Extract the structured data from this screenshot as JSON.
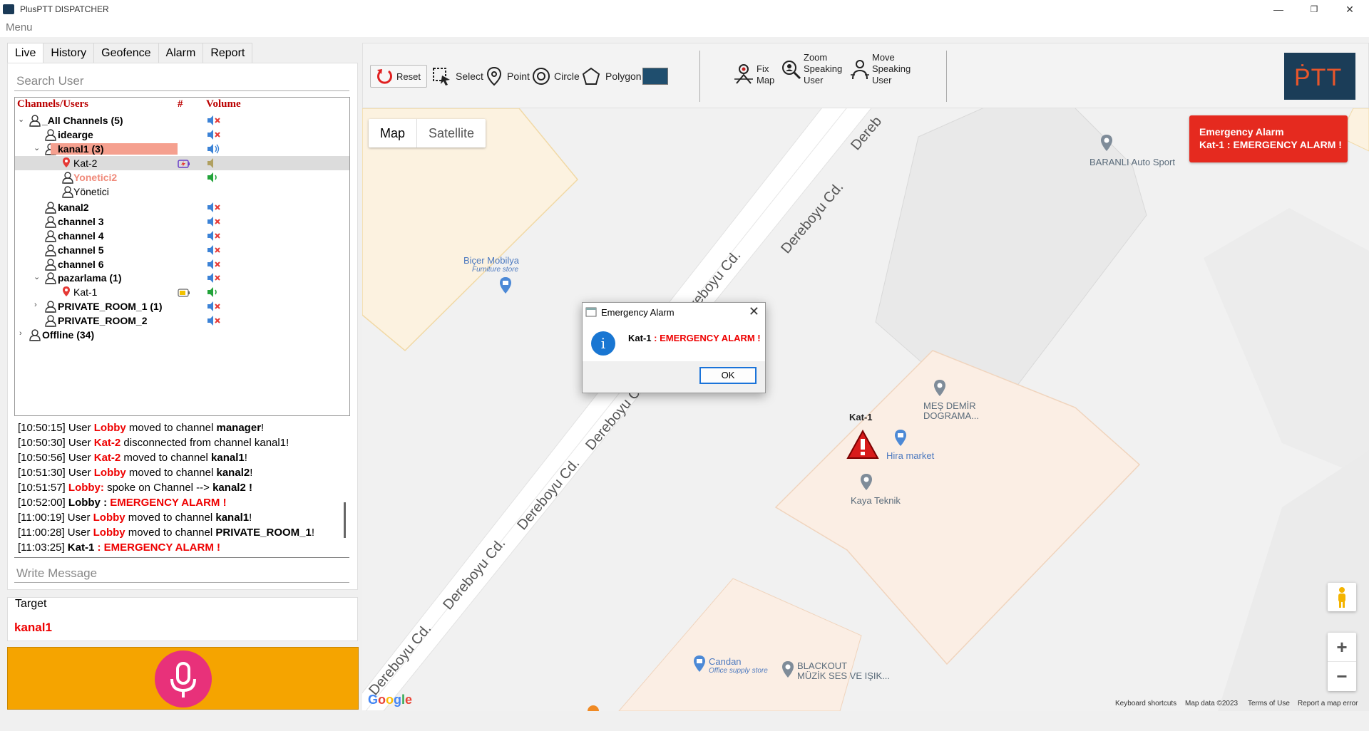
{
  "window": {
    "title": "PlusPTT DISPATCHER",
    "menu": "Menu",
    "min": "—",
    "restore": "❐",
    "close": "✕"
  },
  "tabs": [
    "Live",
    "History",
    "Geofence",
    "Alarm",
    "Report"
  ],
  "search": {
    "placeholder": "Search User"
  },
  "tree": {
    "headers": {
      "name": "Channels/Users",
      "num": "#",
      "volume": "Volume"
    },
    "rows": [
      {
        "label": "_All Channels (5)"
      },
      {
        "label": "idearge"
      },
      {
        "label": "kanal1 (3)"
      },
      {
        "label": "Kat-2"
      },
      {
        "label": "Yonetici2"
      },
      {
        "label": "Yönetici"
      },
      {
        "label": "kanal2"
      },
      {
        "label": "channel 3"
      },
      {
        "label": "channel 4"
      },
      {
        "label": "channel 5"
      },
      {
        "label": "channel 6"
      },
      {
        "label": "pazarlama (1)"
      },
      {
        "label": "Kat-1"
      },
      {
        "label": "PRIVATE_ROOM_1 (1)"
      },
      {
        "label": "PRIVATE_ROOM_2"
      },
      {
        "label": "Offline (34)"
      }
    ]
  },
  "log": [
    {
      "time": "[10:50:15]",
      "pre": "User ",
      "who": "Lobby",
      "mid": " moved to channel ",
      "obj": "manager",
      "end": "!"
    },
    {
      "time": "[10:50:30]",
      "pre": "User ",
      "who": "Kat-2",
      "mid": " disconnected from channel kanal1!",
      "obj": "",
      "end": ""
    },
    {
      "time": "[10:50:56]",
      "pre": "User ",
      "who": "Kat-2",
      "mid": " moved to channel ",
      "obj": "kanal1",
      "end": "!"
    },
    {
      "time": "[10:51:30]",
      "pre": "User ",
      "who": "Lobby",
      "mid": " moved to channel ",
      "obj": "kanal2",
      "end": "!"
    },
    {
      "time": "[10:51:57]",
      "pre": "",
      "who": "Lobby:",
      "mid": " spoke on Channel --> ",
      "obj": "kanal2",
      "end": " !"
    },
    {
      "time": "[10:52:00]",
      "pre": "",
      "who": "Lobby",
      "mid": " : ",
      "obj": "EMERGENCY ALARM !",
      "end": ""
    },
    {
      "time": "[11:00:19]",
      "pre": "User ",
      "who": "Lobby",
      "mid": " moved to channel ",
      "obj": "kanal1",
      "end": "!"
    },
    {
      "time": "[11:00:28]",
      "pre": "User ",
      "who": "Lobby",
      "mid": " moved to channel ",
      "obj": "PRIVATE_ROOM_1",
      "end": "!"
    },
    {
      "time": "[11:03:25]",
      "pre": "",
      "who": "Kat-1",
      "mid": " : ",
      "obj": "EMERGENCY ALARM !",
      "end": ""
    }
  ],
  "message": {
    "placeholder": "Write Message"
  },
  "target": {
    "label": "Target",
    "value": "kanal1"
  },
  "toolbar": {
    "reset": "Reset",
    "select": "Select",
    "point": "Point",
    "circle": "Circle",
    "polygon": "Polygon",
    "swatch_color": "#1f4e6e",
    "fix_map": [
      "Fix",
      "Map"
    ],
    "zoom_speaking": [
      "Zoom",
      "Speaking",
      "User"
    ],
    "move_speaking": [
      "Move",
      "Speaking",
      "User"
    ],
    "logo": "ṖTT"
  },
  "map": {
    "tabs": [
      "Map",
      "Satellite"
    ],
    "streets": [
      "Dereboyu Cd.",
      "Dereboyu Cd.",
      "Dereboyu Cd.",
      "Dereboyu Cd.",
      "Dereboyu Cd.",
      "Dereboyu Cd.",
      "Dereb"
    ],
    "pois": {
      "baranli": "BARANLI Auto Sport",
      "bicer": "Biçer Mobilya",
      "bicer_sub": "Furniture store",
      "mesdemir1": "MEŞ DEMİR",
      "mesdemir2": "DOGRAMA...",
      "hira": "Hira market",
      "kaya": "Kaya Teknik",
      "candan": "Candan",
      "candan_sub": "Office supply store",
      "blackout1": "BLACKOUT",
      "blackout2": "MÜZİK SES VE IŞIK..."
    },
    "marker_label": "Kat-1",
    "alarm_banner": {
      "line1": "Emergency Alarm",
      "who": "Kat-1",
      "msg": " : EMERGENCY ALARM !"
    },
    "google": "Google",
    "attrib": [
      "Keyboard shortcuts",
      "Map data ©2023",
      "Terms of Use",
      "Report a map error"
    ],
    "zoom_in": "+",
    "zoom_out": "−"
  },
  "dialog": {
    "title": "Emergency Alarm",
    "who": "Kat-1",
    "msg": " : EMERGENCY ALARM !",
    "ok": "OK",
    "close": "✕",
    "info": "i"
  }
}
